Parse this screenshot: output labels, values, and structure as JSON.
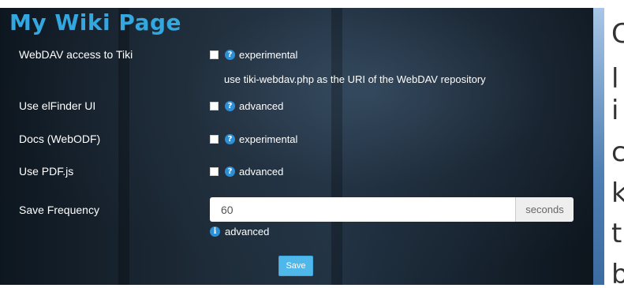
{
  "page": {
    "title": "My Wiki Page"
  },
  "settings": [
    {
      "label": "WebDAV access to Tiki",
      "tag": "experimental",
      "hint": "use tiki-webdav.php as the URI of the WebDAV repository"
    },
    {
      "label": "Use elFinder UI",
      "tag": "advanced"
    },
    {
      "label": "Docs (WebODF)",
      "tag": "experimental"
    },
    {
      "label": "Use PDF.js",
      "tag": "advanced"
    }
  ],
  "save_frequency": {
    "label": "Save Frequency",
    "value": "60",
    "unit": "seconds",
    "tag": "advanced"
  },
  "save_button": {
    "label": "Save"
  },
  "icons": {
    "help": "?",
    "info": "i"
  },
  "side_text": [
    "C",
    "l",
    "i",
    "c",
    "k",
    "t",
    "b"
  ],
  "colors": {
    "title": "#33a7df",
    "help_icon": "#2d8fd5",
    "save_button": "#4fb7ea",
    "strip": "#4f7fb3"
  }
}
